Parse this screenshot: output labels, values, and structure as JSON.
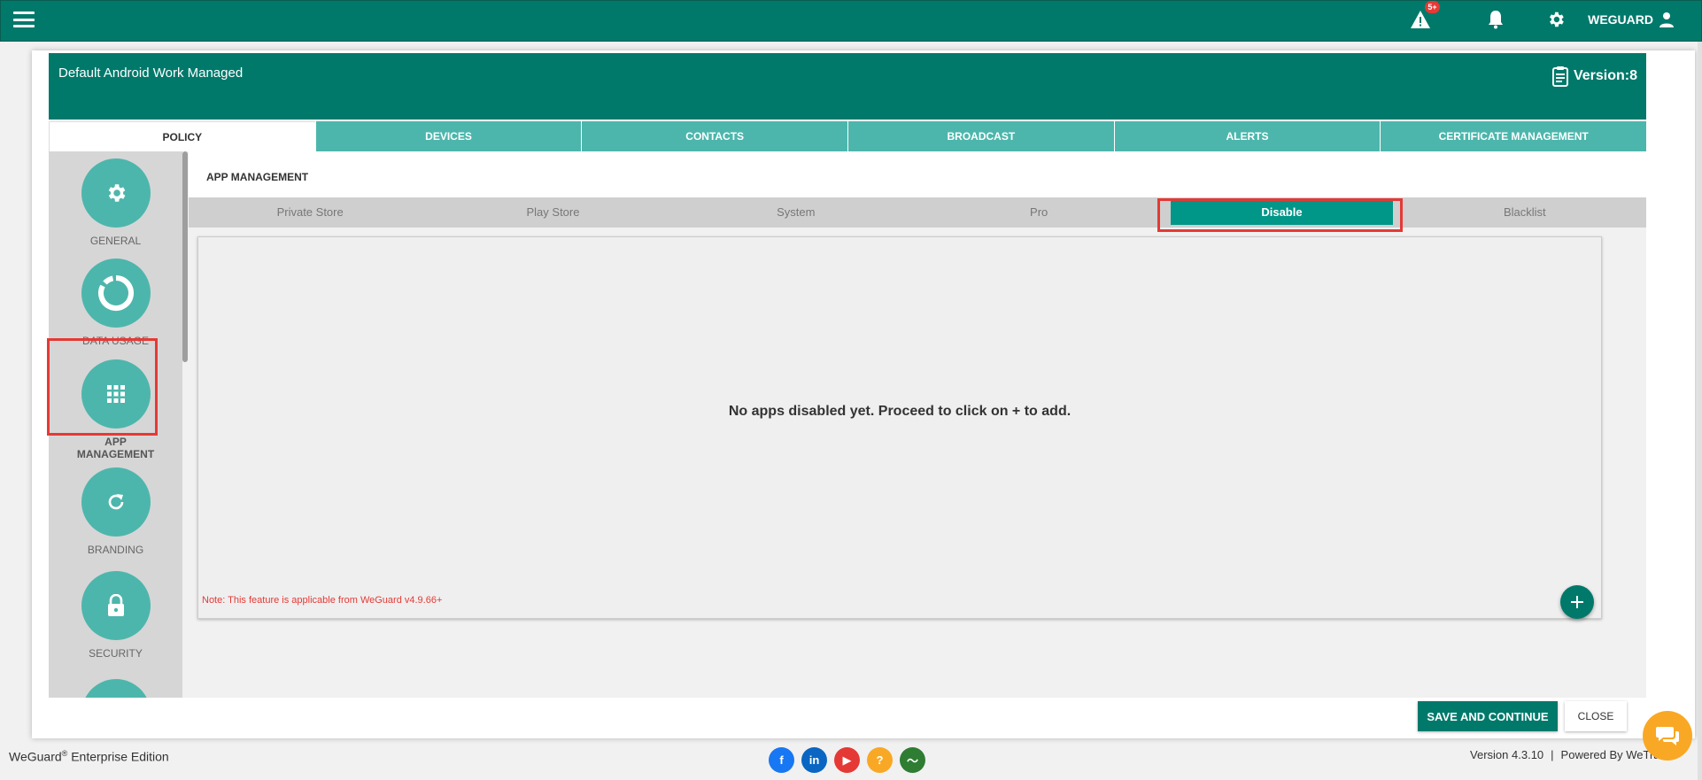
{
  "topbar": {
    "alert_badge": "5+",
    "user_name": "WEGUARD"
  },
  "card": {
    "title": "Default Android Work Managed",
    "version": "Version:8"
  },
  "main_tabs": [
    {
      "label": "POLICY",
      "active": true
    },
    {
      "label": "DEVICES"
    },
    {
      "label": "CONTACTS"
    },
    {
      "label": "BROADCAST"
    },
    {
      "label": "ALERTS"
    },
    {
      "label": "CERTIFICATE MANAGEMENT"
    }
  ],
  "sidebar": {
    "items": [
      {
        "label": "GENERAL",
        "icon": "gear-icon"
      },
      {
        "label": "DATA USAGE",
        "icon": "donut-chart-icon"
      },
      {
        "label": "APP MANAGEMENT",
        "icon": "app-grid-icon",
        "selected": true
      },
      {
        "label": "BRANDING",
        "icon": "refresh-icon"
      },
      {
        "label": "SECURITY",
        "icon": "lock-icon"
      }
    ]
  },
  "section": {
    "title": "APP MANAGEMENT"
  },
  "sub_tabs": [
    {
      "label": "Private Store"
    },
    {
      "label": "Play Store"
    },
    {
      "label": "System"
    },
    {
      "label": "Pro"
    },
    {
      "label": "Disable",
      "active": true
    },
    {
      "label": "Blacklist"
    }
  ],
  "empty_state": {
    "message": "No apps disabled yet. Proceed to click on + to add.",
    "note": "Note: This feature is applicable from WeGuard v4.9.66+"
  },
  "buttons": {
    "save": "SAVE AND CONTINUE",
    "close": "CLOSE"
  },
  "footer": {
    "brand": "WeGuard",
    "brand_mark": "®",
    "edition": " Enterprise Edition",
    "version": "Version 4.3.10",
    "powered": "Powered By WeTrade",
    "social": [
      {
        "name": "facebook-icon",
        "glyph": "f",
        "color": "#1877f2"
      },
      {
        "name": "linkedin-icon",
        "glyph": "in",
        "color": "#0a66c2"
      },
      {
        "name": "youtube-icon",
        "glyph": "▶",
        "color": "#e53935"
      },
      {
        "name": "help-icon",
        "glyph": "?",
        "color": "#f9a825"
      },
      {
        "name": "status-pulse-icon",
        "glyph": "〜",
        "color": "#2e7d32"
      }
    ]
  },
  "colors": {
    "primary": "#00796b",
    "tab": "#4db6ac",
    "highlight": "#e53935"
  }
}
